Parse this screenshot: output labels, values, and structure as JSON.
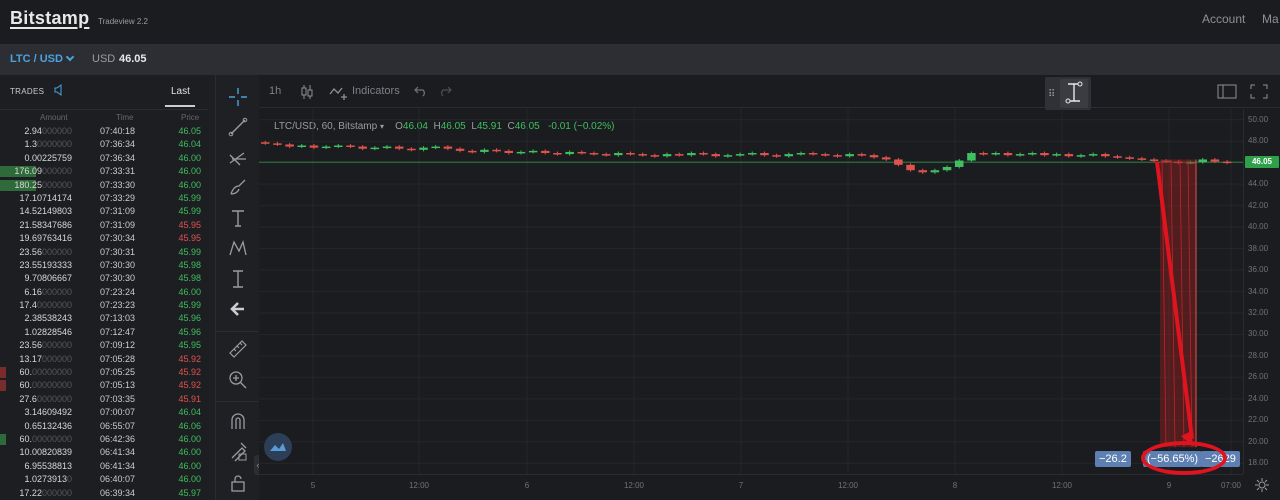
{
  "header": {
    "logo": "Bitstamp",
    "subtitle": "Tradeview 2.2",
    "account": "Account",
    "more": "Ma"
  },
  "pairbar": {
    "pair": "LTC / USD",
    "currency": "USD",
    "price": "46.05"
  },
  "trades": {
    "title": "TRADES",
    "tab_last": "Last",
    "col_amount": "Amount",
    "col_time": "Time",
    "col_price": "Price",
    "rows": [
      {
        "amount": "2.94",
        "pad": "000000",
        "time": "07:40:18",
        "price": "46.05",
        "side": "buy",
        "bar": 0
      },
      {
        "amount": "1.3",
        "pad": "0000000",
        "time": "07:36:34",
        "price": "46.04",
        "side": "buy",
        "bar": 0
      },
      {
        "amount": "0.00225759",
        "pad": "",
        "time": "07:36:34",
        "price": "46.00",
        "side": "buy",
        "bar": 0
      },
      {
        "amount": "176.09",
        "pad": "000000",
        "time": "07:33:31",
        "price": "46.00",
        "side": "buy",
        "bar": 0.12
      },
      {
        "amount": "180.25",
        "pad": "000000",
        "time": "07:33:30",
        "price": "46.00",
        "side": "buy",
        "bar": 0.12
      },
      {
        "amount": "17.10714174",
        "pad": "",
        "time": "07:33:29",
        "price": "45.99",
        "side": "buy",
        "bar": 0
      },
      {
        "amount": "14.52149803",
        "pad": "",
        "time": "07:31:09",
        "price": "45.99",
        "side": "buy",
        "bar": 0
      },
      {
        "amount": "21.58347686",
        "pad": "",
        "time": "07:31:09",
        "price": "45.95",
        "side": "sell",
        "bar": 0
      },
      {
        "amount": "19.69763416",
        "pad": "",
        "time": "07:30:34",
        "price": "45.95",
        "side": "sell",
        "bar": 0
      },
      {
        "amount": "23.56",
        "pad": "000000",
        "time": "07:30:31",
        "price": "45.99",
        "side": "buy",
        "bar": 0
      },
      {
        "amount": "23.55193333",
        "pad": "",
        "time": "07:30:30",
        "price": "45.98",
        "side": "buy",
        "bar": 0
      },
      {
        "amount": "9.70806667",
        "pad": "",
        "time": "07:30:30",
        "price": "45.98",
        "side": "buy",
        "bar": 0
      },
      {
        "amount": "6.16",
        "pad": "000000",
        "time": "07:23:24",
        "price": "46.00",
        "side": "buy",
        "bar": 0
      },
      {
        "amount": "17.4",
        "pad": "0000000",
        "time": "07:23:23",
        "price": "45.99",
        "side": "buy",
        "bar": 0
      },
      {
        "amount": "2.38538243",
        "pad": "",
        "time": "07:13:03",
        "price": "45.96",
        "side": "buy",
        "bar": 0
      },
      {
        "amount": "1.02828546",
        "pad": "",
        "time": "07:12:47",
        "price": "45.96",
        "side": "buy",
        "bar": 0
      },
      {
        "amount": "23.56",
        "pad": "000000",
        "time": "07:09:12",
        "price": "45.95",
        "side": "buy",
        "bar": 0
      },
      {
        "amount": "13.17",
        "pad": "000000",
        "time": "07:05:28",
        "price": "45.92",
        "side": "sell",
        "bar": 0
      },
      {
        "amount": "60.",
        "pad": "00000000",
        "time": "07:05:25",
        "price": "45.92",
        "side": "sell",
        "bar": 0.02
      },
      {
        "amount": "60.",
        "pad": "00000000",
        "time": "07:05:13",
        "price": "45.92",
        "side": "sell",
        "bar": 0.02
      },
      {
        "amount": "27.6",
        "pad": "0000000",
        "time": "07:03:35",
        "price": "45.91",
        "side": "sell",
        "bar": 0
      },
      {
        "amount": "3.14609492",
        "pad": "",
        "time": "07:00:07",
        "price": "46.04",
        "side": "buy",
        "bar": 0
      },
      {
        "amount": "0.65132436",
        "pad": "",
        "time": "06:55:07",
        "price": "46.06",
        "side": "buy",
        "bar": 0
      },
      {
        "amount": "60.",
        "pad": "00000000",
        "time": "06:42:36",
        "price": "46.00",
        "side": "buy",
        "bar": 0.02
      },
      {
        "amount": "10.00820839",
        "pad": "",
        "time": "06:41:34",
        "price": "46.00",
        "side": "buy",
        "bar": 0
      },
      {
        "amount": "6.95538813",
        "pad": "",
        "time": "06:41:34",
        "price": "46.00",
        "side": "buy",
        "bar": 0
      },
      {
        "amount": "1.0273913",
        "pad": "0",
        "time": "06:40:07",
        "price": "46.00",
        "side": "buy",
        "bar": 0
      },
      {
        "amount": "17.22",
        "pad": "000000",
        "time": "06:39:34",
        "price": "45.97",
        "side": "buy",
        "bar": 0
      }
    ]
  },
  "chart_toolbar": {
    "interval": "1h",
    "indicators": "Indicators"
  },
  "legend": {
    "symbol": "LTC/USD, 60, Bitstamp",
    "o_label": "O",
    "o": "46.04",
    "h_label": "H",
    "h": "46.05",
    "l_label": "L",
    "l": "45.91",
    "c_label": "C",
    "c": "46.05",
    "change": "-0.01 (−0.02%)"
  },
  "measure": {
    "left": "−26.2",
    "percent": "(−56.65%)",
    "right": "−2629"
  },
  "colors": {
    "up": "#3fbf5f",
    "down": "#e0534d",
    "accent": "#4aa3df",
    "annotation": "#e0141f"
  },
  "chart_data": {
    "type": "candlestick",
    "title": "LTC/USD, 60, Bitstamp",
    "last_price": "46.05",
    "ylim": [
      17,
      51
    ],
    "y_ticks": [
      "50.00",
      "48.00",
      "46.00",
      "44.00",
      "42.00",
      "40.00",
      "38.00",
      "36.00",
      "34.00",
      "32.00",
      "30.00",
      "28.00",
      "26.00",
      "24.00",
      "22.00",
      "20.00",
      "18.00"
    ],
    "x_ticks": [
      "5",
      "12:00",
      "6",
      "12:00",
      "7",
      "12:00",
      "8",
      "12:00",
      "9",
      "07:00"
    ],
    "series_close": [
      47.8,
      47.7,
      47.5,
      47.6,
      47.4,
      47.5,
      47.6,
      47.5,
      47.3,
      47.4,
      47.5,
      47.3,
      47.2,
      47.4,
      47.5,
      47.3,
      47.1,
      47.0,
      47.2,
      47.1,
      46.9,
      47.0,
      47.1,
      46.9,
      46.8,
      47.0,
      46.9,
      46.8,
      46.7,
      46.9,
      46.8,
      46.7,
      46.6,
      46.8,
      46.7,
      46.9,
      46.8,
      46.6,
      46.7,
      46.8,
      46.9,
      46.7,
      46.6,
      46.8,
      46.9,
      46.8,
      46.7,
      46.6,
      46.8,
      46.7,
      46.5,
      46.3,
      45.8,
      45.3,
      45.1,
      45.3,
      45.6,
      46.2,
      46.9,
      46.8,
      46.9,
      46.7,
      46.8,
      46.9,
      46.7,
      46.8,
      46.6,
      46.7,
      46.8,
      46.6,
      46.5,
      46.4,
      46.3,
      46.2,
      46.1,
      46.0,
      46.05,
      46.3,
      46.1,
      46.0
    ]
  }
}
